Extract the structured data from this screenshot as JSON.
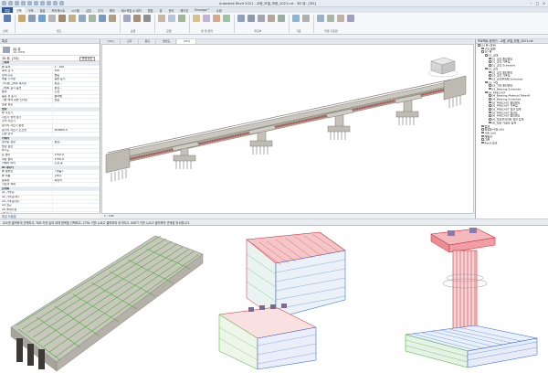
{
  "window": {
    "title": "Autodesk Revit 2021 - 교량_모델_최종_2021.rvt - 3D 뷰: {3D}"
  },
  "ribbon": {
    "file_tab": "파일",
    "tabs": [
      "건축",
      "구조",
      "철골",
      "프리캐스트",
      "시스템",
      "삽입",
      "주석",
      "해석",
      "매스작업 & 대지",
      "협업",
      "뷰",
      "관리",
      "애드인",
      "Enscape™",
      "수정"
    ],
    "active_tab": "건축",
    "panels": [
      "선택",
      "빌드",
      "순환",
      "모델",
      "방 및 면적",
      "개구부",
      "기준",
      "작업 기준면"
    ]
  },
  "properties": {
    "header": "특성",
    "type_name": "3D 뷰",
    "type_sub": "3D View",
    "filter_label": "3D 뷰: {3D}",
    "edit_type": "유형 편집",
    "rows": [
      {
        "k": "그래픽",
        "v": "",
        "group": true
      },
      {
        "k": "뷰 축척",
        "v": "1 : 100"
      },
      {
        "k": "축척 값  1:",
        "v": "100"
      },
      {
        "k": "상세 수준",
        "v": "높음"
      },
      {
        "k": "부품 가시성",
        "v": "원본 표시"
      },
      {
        "k": "가시성/그래픽 재지정",
        "v": "편집..."
      },
      {
        "k": "그래픽 표시 옵션",
        "v": "편집..."
      },
      {
        "k": "분야",
        "v": "조정"
      },
      {
        "k": "숨은 선 표시",
        "v": "분야별"
      },
      {
        "k": "기본 해석 화면 스타일",
        "v": "없음"
      },
      {
        "k": "일광 경로",
        "v": ""
      },
      {
        "k": "범위",
        "v": "",
        "group": true
      },
      {
        "k": "뷰 자르기",
        "v": ""
      },
      {
        "k": "자르기 영역 보기",
        "v": ""
      },
      {
        "k": "주석 자르기",
        "v": ""
      },
      {
        "k": "원거리 자르기 활성",
        "v": ""
      },
      {
        "k": "원거리 자르기 오프셋",
        "v": "304800.0"
      },
      {
        "k": "단면 상자",
        "v": ""
      },
      {
        "k": "카메라",
        "v": "",
        "group": true
      },
      {
        "k": "렌더링 설정",
        "v": "편집..."
      },
      {
        "k": "방향 잠금",
        "v": ""
      },
      {
        "k": "투시도",
        "v": ""
      },
      {
        "k": "눈 높이",
        "v": "1750.0"
      },
      {
        "k": "대상 높이",
        "v": "1750.0"
      },
      {
        "k": "카메라 위치",
        "v": "조정 중"
      },
      {
        "k": "ID 데이터",
        "v": "",
        "group": true
      },
      {
        "k": "뷰 템플릿",
        "v": "<없음>"
      },
      {
        "k": "뷰 이름",
        "v": "{3D}"
      },
      {
        "k": "종속성",
        "v": "독립적"
      },
      {
        "k": "시트의 제목",
        "v": ""
      },
      {
        "k": "단계화",
        "v": "",
        "group": true
      },
      {
        "k": "a1_거푸집",
        "v": ""
      },
      {
        "k": "a2_거푸집(외)",
        "v": ""
      },
      {
        "k": "a3_거푸집(내)",
        "v": ""
      },
      {
        "k": "a4_철근",
        "v": ""
      },
      {
        "k": "a5_부대시설",
        "v": ""
      },
      {
        "k": "a6_토공",
        "v": ""
      }
    ],
    "help_link": "특성 도움말",
    "apply": "적용"
  },
  "view_tabs": [
    "{3D}",
    "교각",
    "종단",
    "평면도",
    "{3D}"
  ],
  "view_control": "1 : 100",
  "browser": {
    "header": "프로젝트 탐색기 - 교량_모델_최종_2021.rvt",
    "items": [
      {
        "label": "[0] 뷰 (모두)",
        "level": 0
      },
      {
        "label": "구조 평면",
        "level": 1
      },
      {
        "label": "3D 뷰",
        "level": 1
      },
      {
        "label": "01_교대",
        "level": 2
      },
      {
        "label": "01_교각 종단면도",
        "level": 3
      },
      {
        "label": "01_교각 거푸집",
        "level": 3
      },
      {
        "label": "01_교각 Schedule",
        "level": 3
      },
      {
        "label": "02_교각",
        "level": 2
      },
      {
        "label": "02_교각 종단면도",
        "level": 3
      },
      {
        "label": "02_교각 거푸집",
        "level": 3
      },
      {
        "label": "02_교각부속체 Schedule",
        "level": 3
      },
      {
        "label": "03_거더",
        "level": 2
      },
      {
        "label": "03_거더 종단면도",
        "level": 3
      },
      {
        "label": "03_Bearing Schedule",
        "level": 3
      },
      {
        "label": "04_PRECAST",
        "level": 2
      },
      {
        "label": "04_Bearing Material Takeoff",
        "level": 3
      },
      {
        "label": "04_Bearing Schedule",
        "level": 3
      },
      {
        "label": "05_PRECAST 종단면도",
        "level": 3
      },
      {
        "label": "05_PRECAST 거푸집",
        "level": 3
      },
      {
        "label": "05_PRECAST 철근 집계",
        "level": 3
      },
      {
        "label": "05_PRECAST 철근도",
        "level": 3
      },
      {
        "label": "06_PRECAST 종단면도",
        "level": 3
      },
      {
        "label": "06_철근콘크리트 철근 집계",
        "level": 3
      },
      {
        "label": "06_철근 가공도 집계",
        "level": 3
      },
      {
        "label": "범례",
        "level": 1
      },
      {
        "label": "일람표/수량 (all)",
        "level": 1
      },
      {
        "label": "시트 (all)",
        "level": 1
      },
      {
        "label": "패밀리",
        "level": 1
      },
      {
        "label": "그룹",
        "level": 1
      },
      {
        "label": "Revit 링크",
        "level": 1
      }
    ]
  },
  "status": {
    "text": "요소를 클릭하여 선택하고, TAB 키를 눌러 대체 항목을 선택하고, CTRL 키를 누르고 클릭하여 추가하고, SHIFT 키를 누르고 클릭하여 선택을 취소합니다."
  },
  "colors": {
    "ribbon_file": "#2b5797",
    "concrete": "#bfbcb4",
    "rebar_green": "#3fae2a",
    "rebar_red": "#d8202a",
    "rebar_blue": "#1f5fd0",
    "girder_red": "#b53a3a"
  }
}
